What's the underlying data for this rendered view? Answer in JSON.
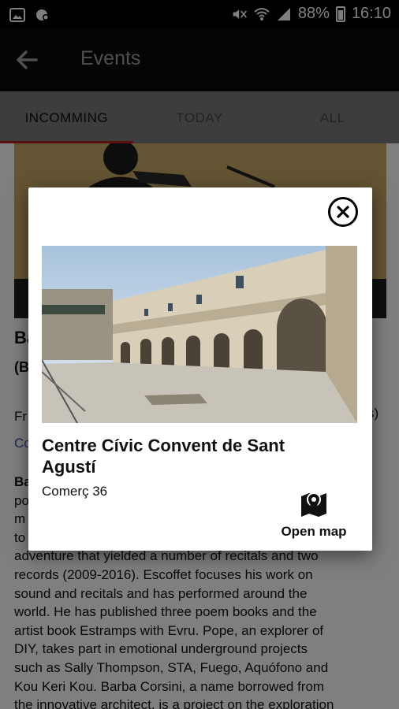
{
  "status_bar": {
    "battery": "88%",
    "time": "16:10"
  },
  "appbar": {
    "title": "Events"
  },
  "tabs": [
    {
      "label": "INCOMMING",
      "active": true
    },
    {
      "label": "TODAY",
      "active": false
    },
    {
      "label": "ALL",
      "active": false
    }
  ],
  "background": {
    "ghost_a": "Ba",
    "ghost_b": "(B",
    "ghost_c": "Fr",
    "ghost_d": "s)",
    "ghost_e": "Co",
    "body_lines": [
      "Ba",
      "po",
      "m",
      "to",
      "adventure that yielded a number of recitals and two",
      "records (2009-2016). Escoffet focuses his work on",
      "sound and recitals and has performed around the",
      "world. He has published three poem books and the",
      "artist book Estramps with Evru. Pope, an explorer of",
      "DIY, takes part in emotional underground projects",
      "such as Sally Thompson, STA, Fuego, Aquófono and",
      "Kou Keri Kou. Barba Corsini, a name borrowed from",
      "the innovative architect, is a project on the exploration"
    ]
  },
  "dialog": {
    "place_name": "Centre Cívic Convent de Sant Agustí",
    "address": "Comerç 36",
    "open_map_label": "Open map"
  }
}
